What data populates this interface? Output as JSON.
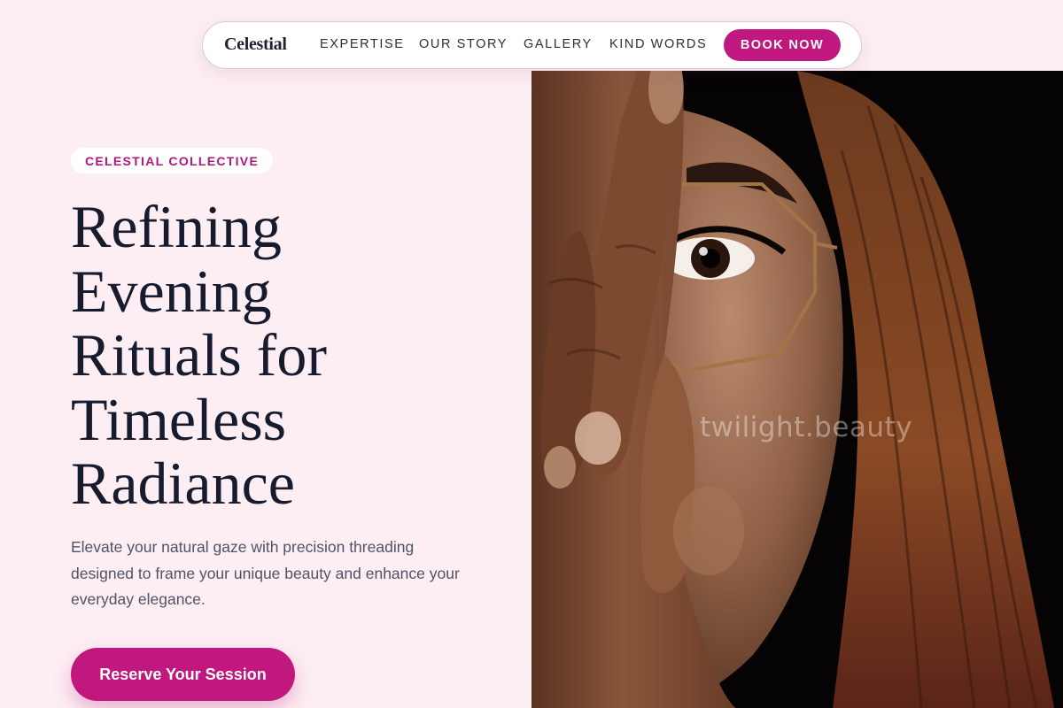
{
  "nav": {
    "brand": "Celestial",
    "links": [
      "EXPERTISE",
      "OUR STORY",
      "GALLERY",
      "KIND WORDS"
    ],
    "cta": "BOOK NOW"
  },
  "hero": {
    "badge": "CELESTIAL COLLECTIVE",
    "headline_lines": [
      "Refining",
      "Evening",
      "Rituals for",
      "Timeless",
      "Radiance"
    ],
    "subtext": "Elevate your natural gaze with precision threading designed to frame your unique beauty and enhance your everyday elegance.",
    "cta": "Reserve Your Session"
  },
  "photo": {
    "watermark": "twilight.beauty"
  },
  "colors": {
    "background": "#fdeef3",
    "accent": "#c0187e",
    "text_dark": "#161b2e",
    "text_muted": "#4e5467"
  }
}
